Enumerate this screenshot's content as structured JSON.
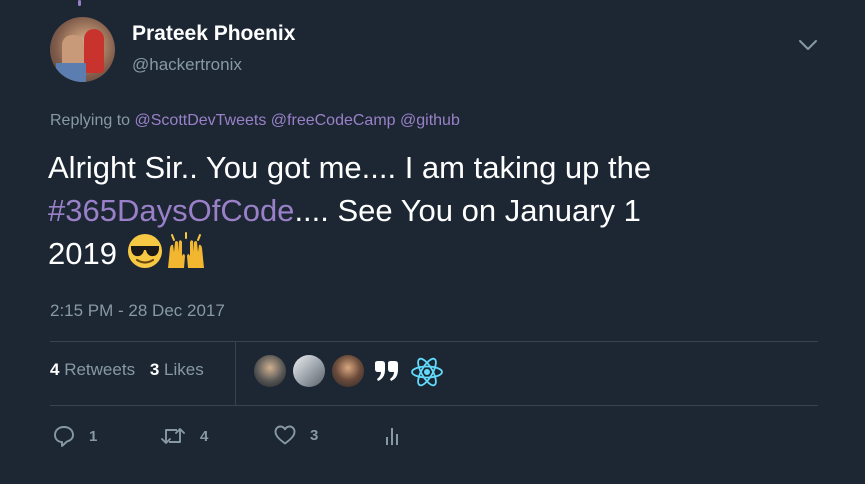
{
  "tweet": {
    "author_name": "Prateek Phoenix",
    "author_handle": "@hackertronix",
    "replying_prefix": "Replying to",
    "replying_mentions": [
      "@ScottDevTweets",
      "@freeCodeCamp",
      "@github"
    ],
    "text_line1": "Alright Sir.. You got me.... I am taking up the",
    "hashtag": "#365DaysOfCode",
    "text_line2_rest": ".... See You on January 1",
    "text_line3": "2019",
    "emojis": [
      "smiling-face-with-sunglasses",
      "raising-hands"
    ],
    "timestamp": "2:15 PM - 28 Dec 2017"
  },
  "stats": {
    "retweets_count": "4",
    "retweets_label": "Retweets",
    "likes_count": "3",
    "likes_label": "Likes"
  },
  "likers": [
    "avatar-1",
    "avatar-2",
    "avatar-3",
    "quote-avatar",
    "react-logo-avatar"
  ],
  "actions": {
    "reply_count": "1",
    "retweet_count": "4",
    "like_count": "3"
  },
  "colors": {
    "background": "#1c2733",
    "accent": "#9a80c8",
    "muted": "#8899a6",
    "divider": "#38444d",
    "react": "#61dafb"
  }
}
